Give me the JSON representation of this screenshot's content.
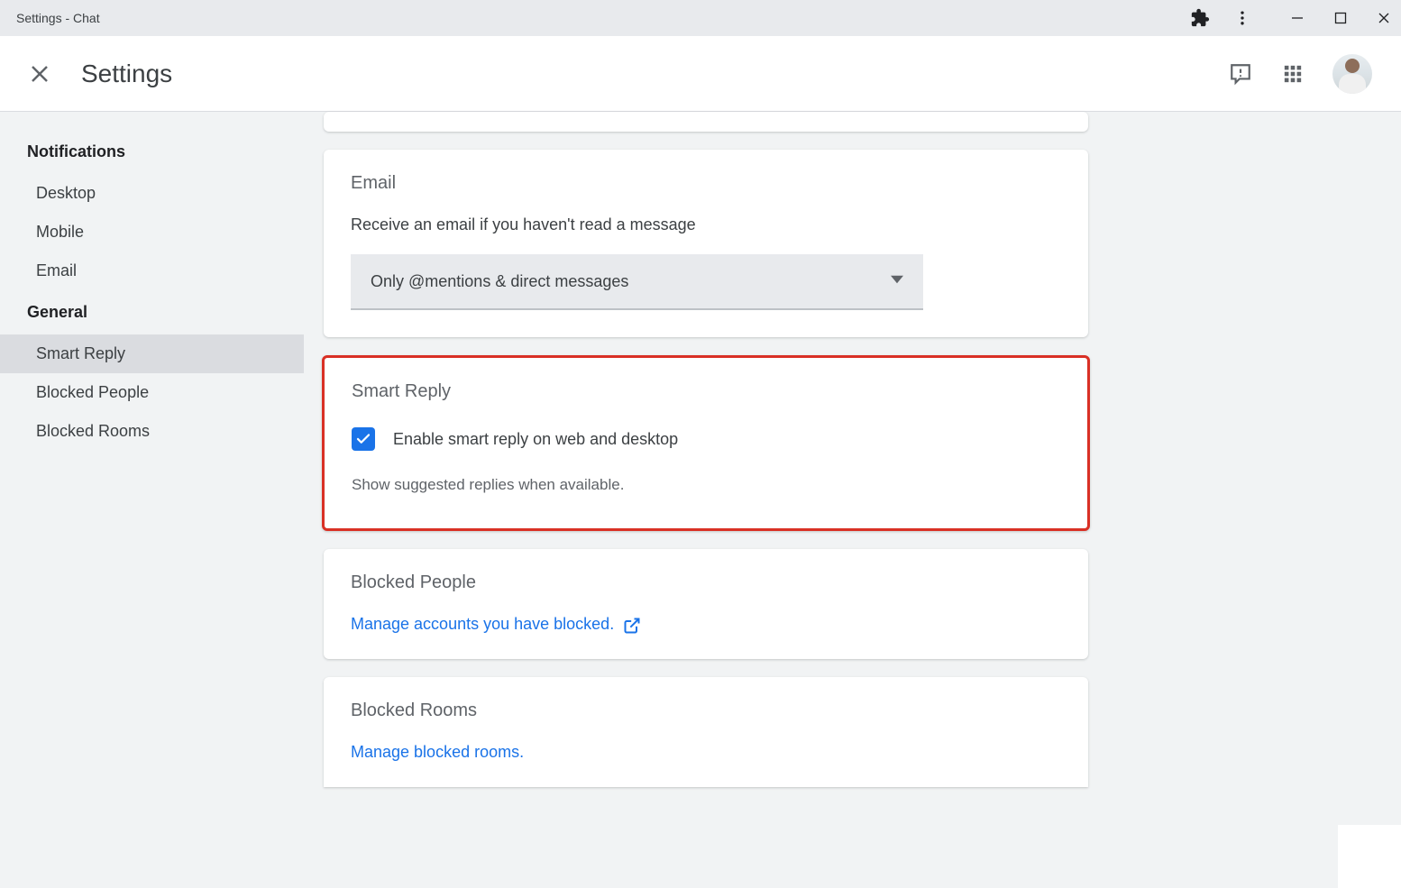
{
  "titlebar": {
    "title": "Settings - Chat"
  },
  "header": {
    "title": "Settings"
  },
  "sidebar": {
    "groups": [
      {
        "title": "Notifications",
        "items": [
          {
            "label": "Desktop"
          },
          {
            "label": "Mobile"
          },
          {
            "label": "Email"
          }
        ]
      },
      {
        "title": "General",
        "items": [
          {
            "label": "Smart Reply"
          },
          {
            "label": "Blocked People"
          },
          {
            "label": "Blocked Rooms"
          }
        ]
      }
    ]
  },
  "email_card": {
    "title": "Email",
    "description": "Receive an email if you haven't read a message",
    "select_value": "Only @mentions & direct messages"
  },
  "smart_reply_card": {
    "title": "Smart Reply",
    "checkbox_label": "Enable smart reply on web and desktop",
    "helper": "Show suggested replies when available."
  },
  "blocked_people_card": {
    "title": "Blocked People",
    "link": "Manage accounts you have blocked."
  },
  "blocked_rooms_card": {
    "title": "Blocked Rooms",
    "link": "Manage blocked rooms."
  }
}
